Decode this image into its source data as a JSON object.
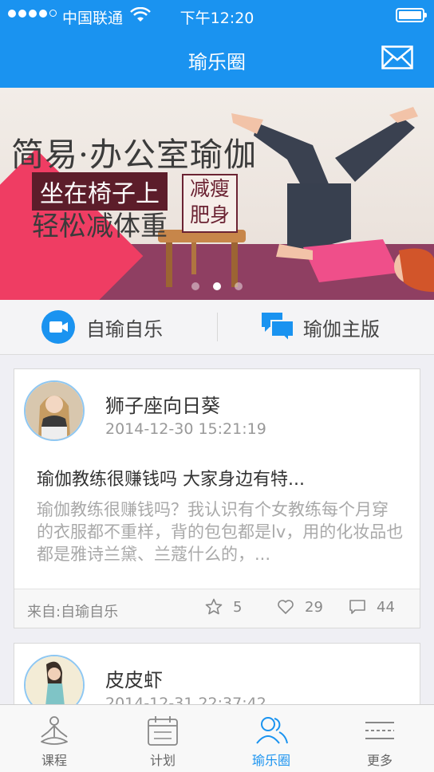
{
  "status_bar": {
    "carrier": "中国联通",
    "time": "下午12:20"
  },
  "nav": {
    "title": "瑜乐圈"
  },
  "banner": {
    "headline": "简易·办公室瑜伽",
    "subline1": "坐在椅子上",
    "subline2": "轻松减体重",
    "tag_line1": "减瘦",
    "tag_line2": "肥身",
    "page_count": 3,
    "active_page": 2
  },
  "segments": [
    {
      "label": "自瑜自乐",
      "icon": "video-camera-icon"
    },
    {
      "label": "瑜伽主版",
      "icon": "chat-bubbles-icon"
    }
  ],
  "posts": [
    {
      "author": "狮子座向日葵",
      "time": "2014-12-30 15:21:19",
      "title": "瑜伽教练很赚钱吗 大家身边有特...",
      "body": "瑜伽教练很赚钱吗？我认识有个女教练每个月穿的衣服都不重样，背的包包都是lv，用的化妆品也都是雅诗兰黛、兰蔻什么的，...",
      "source": "来自:自瑜自乐",
      "stars": "5",
      "likes": "29",
      "comments": "44"
    },
    {
      "author": "皮皮虾",
      "time": "2014-12-31 22:37:42"
    }
  ],
  "tabs": [
    {
      "label": "课程",
      "icon": "meditation-icon"
    },
    {
      "label": "计划",
      "icon": "calendar-icon"
    },
    {
      "label": "瑜乐圈",
      "icon": "people-icon",
      "active": true
    },
    {
      "label": "更多",
      "icon": "more-lines-icon"
    }
  ],
  "colors": {
    "primary": "#1a93f0",
    "banner_pink": "#ef3d63",
    "banner_maroon": "#5c1d2a"
  }
}
